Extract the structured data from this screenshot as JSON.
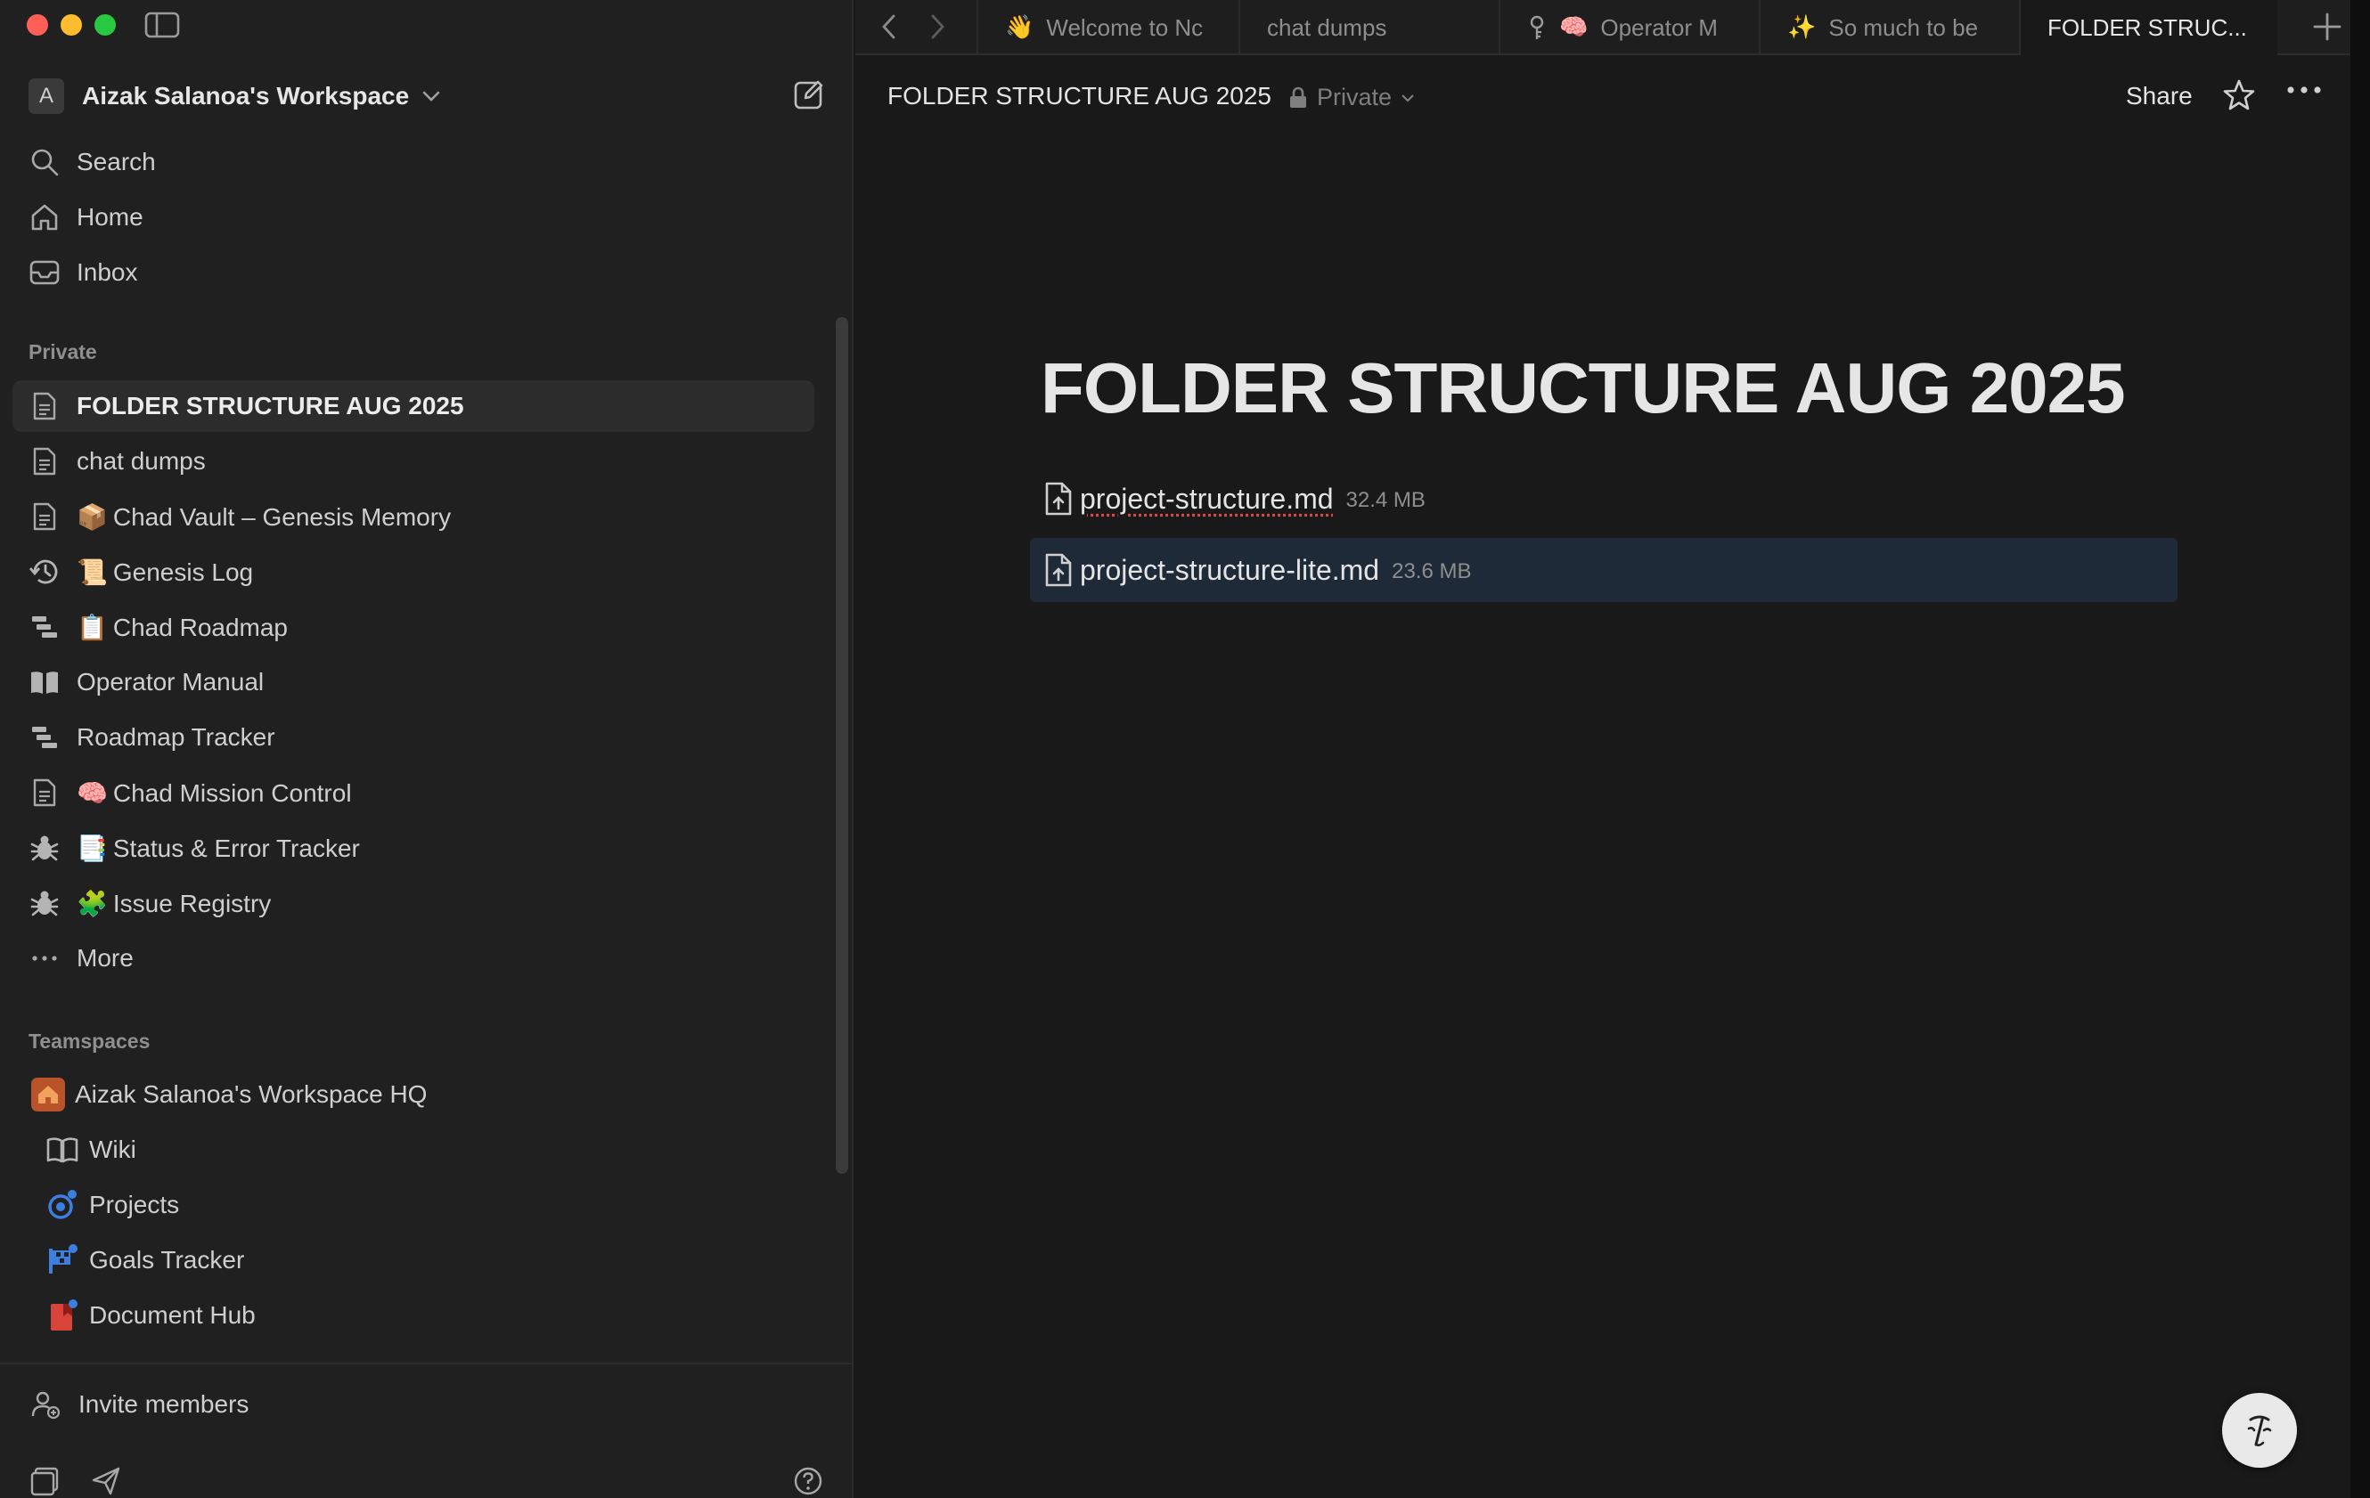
{
  "sidebar": {
    "workspace_initial": "A",
    "workspace_name": "Aizak Salanoa's Workspace",
    "top_nav": [
      {
        "label": "Search",
        "icon": "search-icon"
      },
      {
        "label": "Home",
        "icon": "home-icon"
      },
      {
        "label": "Inbox",
        "icon": "inbox-icon"
      }
    ],
    "private_label": "Private",
    "private_items": [
      {
        "label": "FOLDER STRUCTURE AUG 2025",
        "emoji": "",
        "icon": "page-icon",
        "active": true
      },
      {
        "label": "chat dumps",
        "emoji": "",
        "icon": "page-icon"
      },
      {
        "label": "Chad Vault – Genesis Memory",
        "emoji": "📦",
        "icon": "page-icon"
      },
      {
        "label": "Genesis Log",
        "emoji": "📜",
        "icon": "history-icon"
      },
      {
        "label": "Chad Roadmap",
        "emoji": "📋",
        "icon": "timeline-icon"
      },
      {
        "label": "Operator Manual",
        "emoji": "",
        "icon": "book-icon"
      },
      {
        "label": "Roadmap Tracker",
        "emoji": "",
        "icon": "timeline-icon"
      },
      {
        "label": "Chad Mission Control",
        "emoji": "🧠",
        "icon": "page-icon"
      },
      {
        "label": "Status & Error Tracker",
        "emoji": "📑",
        "icon": "bug-icon"
      },
      {
        "label": "Issue Registry",
        "emoji": "🧩",
        "icon": "bug-icon"
      }
    ],
    "more_label": "More",
    "teamspaces_label": "Teamspaces",
    "teamspace_name": "Aizak Salanoa's Workspace HQ",
    "teamspace_items": [
      {
        "label": "Wiki",
        "icon": "wiki-book-icon"
      },
      {
        "label": "Projects",
        "icon": "projects-icon"
      },
      {
        "label": "Goals Tracker",
        "icon": "goals-icon"
      },
      {
        "label": "Document Hub",
        "icon": "document-hub-icon"
      }
    ],
    "invite_label": "Invite members"
  },
  "tabs": [
    {
      "label": "Welcome to Nc",
      "emoji": "👋"
    },
    {
      "label": "chat dumps",
      "emoji": ""
    },
    {
      "label": "Operator M",
      "emoji": "🧠"
    },
    {
      "label": "So much to be",
      "emoji": "✨"
    },
    {
      "label": "FOLDER STRUC...",
      "emoji": "",
      "active": true
    }
  ],
  "header": {
    "breadcrumb": "FOLDER STRUCTURE AUG 2025",
    "privacy": "Private",
    "share_label": "Share"
  },
  "page": {
    "title": "FOLDER STRUCTURE AUG 2025",
    "files": [
      {
        "name": "project-structure.md",
        "size": "32.4 MB"
      },
      {
        "name": "project-structure-lite.md",
        "size": "23.6 MB"
      }
    ]
  },
  "colors": {
    "background": "#191919",
    "sidebar": "#202020",
    "selected_row": "#1f2a38",
    "accent_blue": "#3d7fe0",
    "hub_red": "#d9443a"
  }
}
